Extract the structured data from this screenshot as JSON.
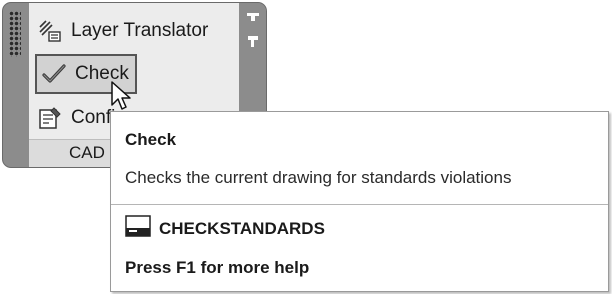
{
  "panel": {
    "title": "CAD",
    "commands": [
      {
        "label": "Layer Translator",
        "icon": "layer-translator-icon"
      },
      {
        "label": "Check",
        "icon": "checkmark-icon"
      },
      {
        "label": "Configure",
        "icon": "configure-icon"
      }
    ]
  },
  "tooltip": {
    "title": "Check",
    "description": "Checks the current drawing for standards violations",
    "command": "CHECKSTANDARDS",
    "help": "Press F1 for more help"
  }
}
